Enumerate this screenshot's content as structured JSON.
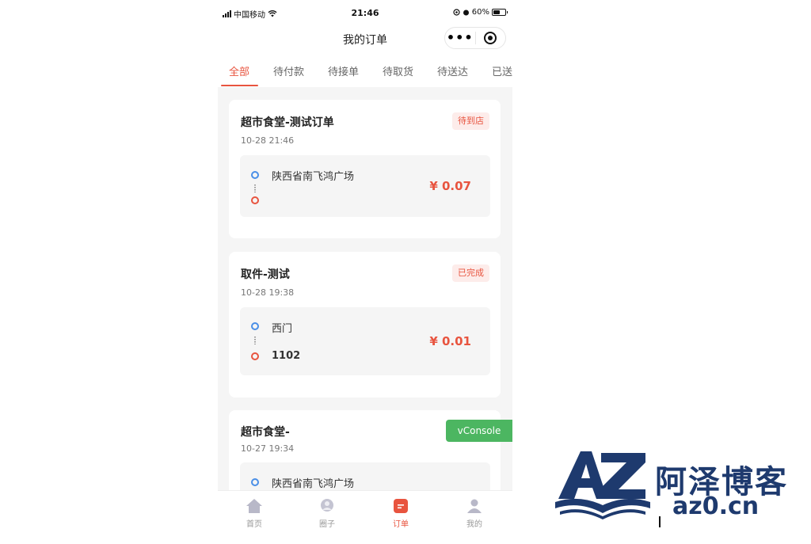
{
  "status_bar": {
    "carrier": "中国移动",
    "time": "21:46",
    "battery": "60%",
    "battery_level": 0.6
  },
  "nav": {
    "title": "我的订单",
    "more_label": "•••"
  },
  "tabs": [
    {
      "label": "全部",
      "active": true
    },
    {
      "label": "待付款"
    },
    {
      "label": "待接单"
    },
    {
      "label": "待取货"
    },
    {
      "label": "待送达"
    },
    {
      "label": "已送"
    }
  ],
  "orders": [
    {
      "title": "超市食堂-测试订单",
      "time": "10-28 21:46",
      "status": "待到店",
      "from": "陕西省南飞鸿广场",
      "to": "",
      "price": "¥ 0.07"
    },
    {
      "title": "取件-测试",
      "time": "10-28 19:38",
      "status": "已完成",
      "from": "西门",
      "to": "1102",
      "price": "¥ 0.01"
    },
    {
      "title": "超市食堂-",
      "time": "10-27 19:34",
      "status": "",
      "from": "陕西省南飞鸿广场",
      "to": "",
      "price": ""
    }
  ],
  "vconsole": "vConsole",
  "tabbar": [
    {
      "label": "首页",
      "icon": "home-icon"
    },
    {
      "label": "圈子",
      "icon": "circle-icon"
    },
    {
      "label": "订单",
      "icon": "order-icon",
      "active": true
    },
    {
      "label": "我的",
      "icon": "profile-icon"
    }
  ],
  "watermark": {
    "logo_text": "AZ",
    "name": "阿泽博客",
    "url": "az0.cn"
  },
  "colors": {
    "accent": "#e8543f",
    "start_dot": "#4a8fe7",
    "vconsole": "#4cb661",
    "logo": "#1e3a6e"
  }
}
